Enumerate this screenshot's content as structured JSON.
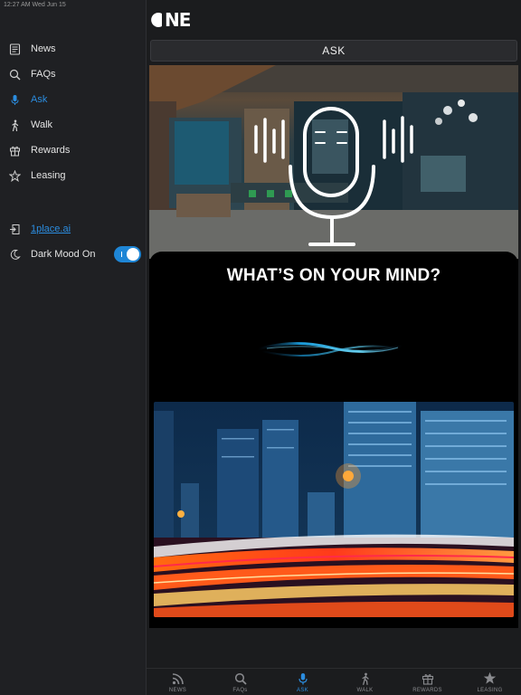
{
  "status_bar": {
    "text": "12:27 AM   Wed Jun 15"
  },
  "sidebar": {
    "items": [
      {
        "label": "News",
        "icon": "news-icon"
      },
      {
        "label": "FAQs",
        "icon": "search-icon"
      },
      {
        "label": "Ask",
        "icon": "microphone-icon",
        "active": true
      },
      {
        "label": "Walk",
        "icon": "walking-person-icon"
      },
      {
        "label": "Rewards",
        "icon": "gift-icon"
      },
      {
        "label": "Leasing",
        "icon": "star-icon"
      }
    ],
    "link": {
      "label": "1place.ai",
      "icon": "external-link-icon"
    },
    "dark_mode": {
      "label": "Dark Mood On",
      "icon": "moon-icon",
      "on": true
    }
  },
  "header": {
    "logo_text": "NE",
    "page_title": "ASK"
  },
  "hero": {
    "headline": "WHAT’S ON YOUR MIND?"
  },
  "bottom_tabs": [
    {
      "label": "NEWS",
      "icon": "rss-icon"
    },
    {
      "label": "FAQs",
      "icon": "search-icon"
    },
    {
      "label": "ASK",
      "icon": "microphone-icon",
      "active": true
    },
    {
      "label": "WALK",
      "icon": "walking-person-icon"
    },
    {
      "label": "REWARDS",
      "icon": "gift-icon"
    },
    {
      "label": "LEASING",
      "icon": "star-icon"
    }
  ],
  "colors": {
    "accent": "#2b8de0",
    "sidebar_bg": "#1f2023",
    "main_bg": "#1b1c1e"
  }
}
